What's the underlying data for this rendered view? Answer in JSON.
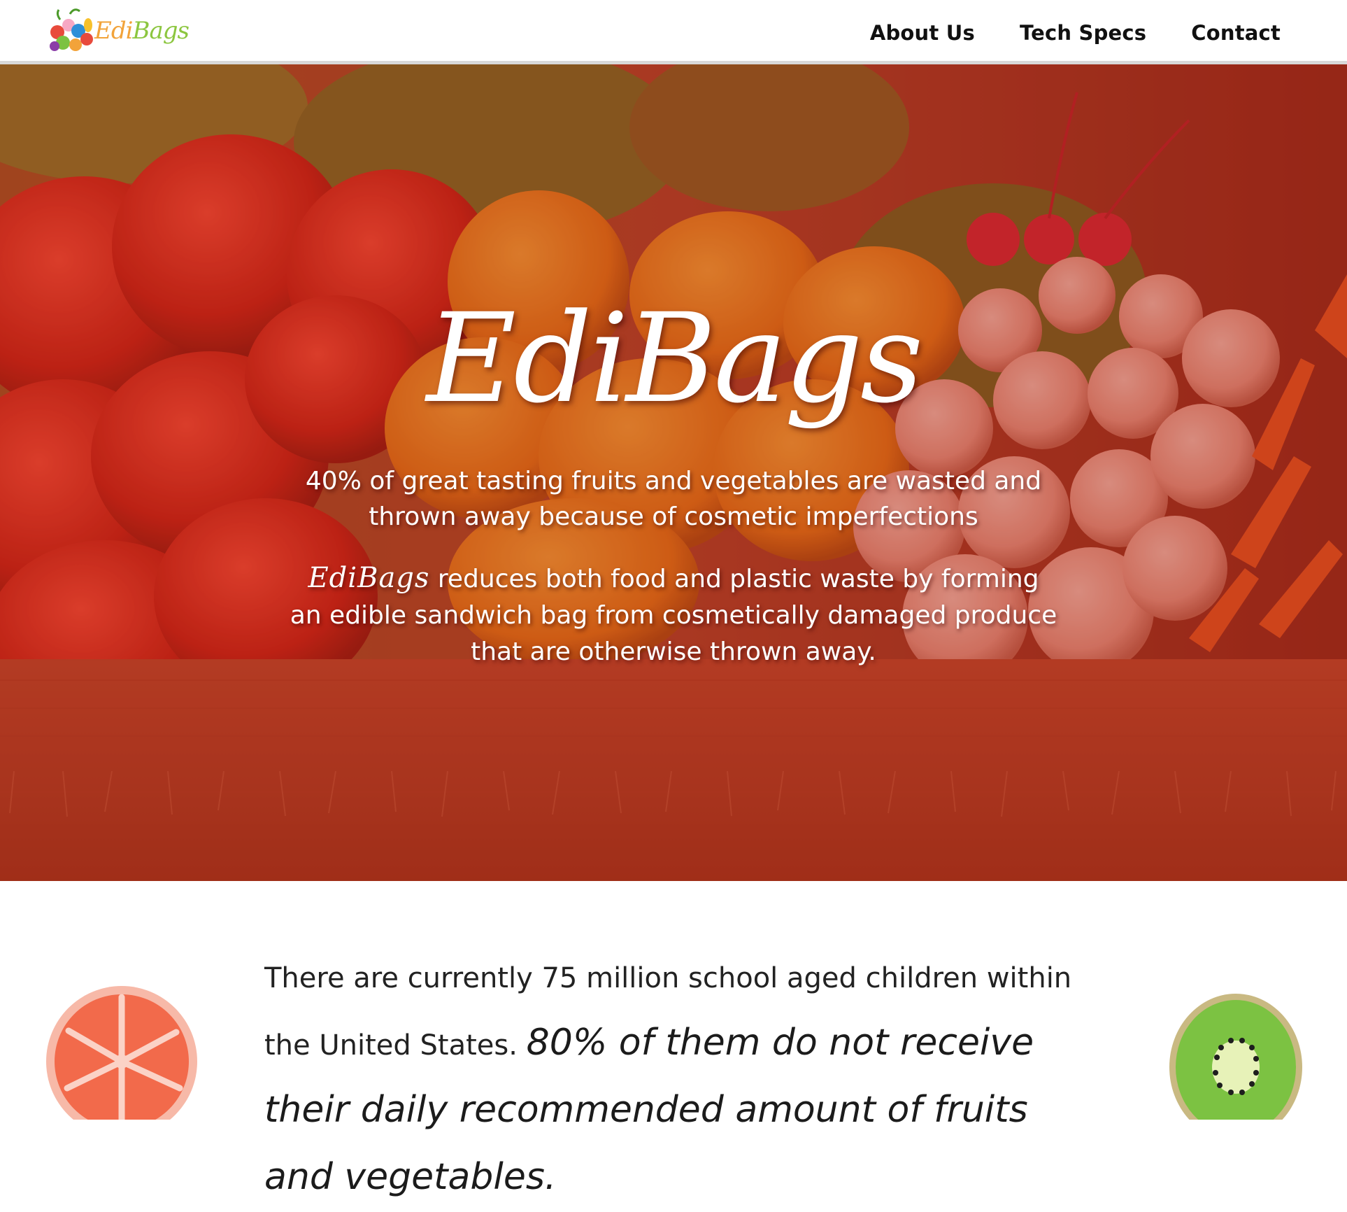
{
  "navbar": {
    "logo_text_edi": "Edi",
    "logo_text_bags": "Bags",
    "links": [
      "About Us",
      "Tech Specs",
      "Contact"
    ]
  },
  "hero": {
    "title": "EdiBags",
    "line1": "40% of great tasting fruits and vegetables are wasted and thrown away because of cosmetic imperfections",
    "line2_brand": "EdiBags",
    "line2_rest": " reduces both food and plastic waste by forming an edible sandwich bag from cosmetically damaged produce that are otherwise thrown away."
  },
  "stat": {
    "plain": "There are currently 75 million school aged children within the United States. ",
    "emphasis": "80% of them do not receive their daily recommended amount of fruits and vegetables."
  },
  "colors": {
    "hero_overlay": "#c0381e",
    "logo_orange": "#f2a33a",
    "logo_green": "#8cc63f",
    "grapefruit": "#f26a4b",
    "kiwi": "#7cc242"
  },
  "icons": {
    "logo": "produce-cluster-logo",
    "left": "grapefruit-slice-icon",
    "right": "kiwi-slice-icon"
  }
}
